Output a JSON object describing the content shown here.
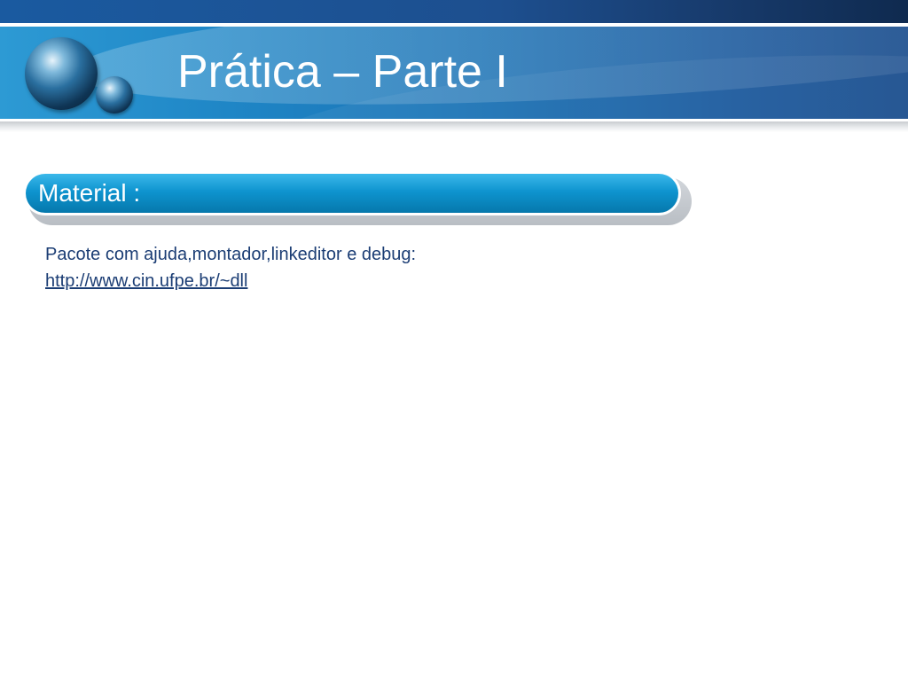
{
  "slide": {
    "title": "Prática – Parte I",
    "section": {
      "label": "Material :"
    },
    "content": {
      "line1": "Pacote com ajuda,montador,linkeditor e debug:",
      "link": "http://www.cin.ufpe.br/~dll"
    }
  },
  "colors": {
    "header_blue": "#1f86c6",
    "pill_blue": "#0e94cf",
    "text_navy": "#1b3d74"
  },
  "icons": {
    "logo": "globe-logo-icon"
  }
}
